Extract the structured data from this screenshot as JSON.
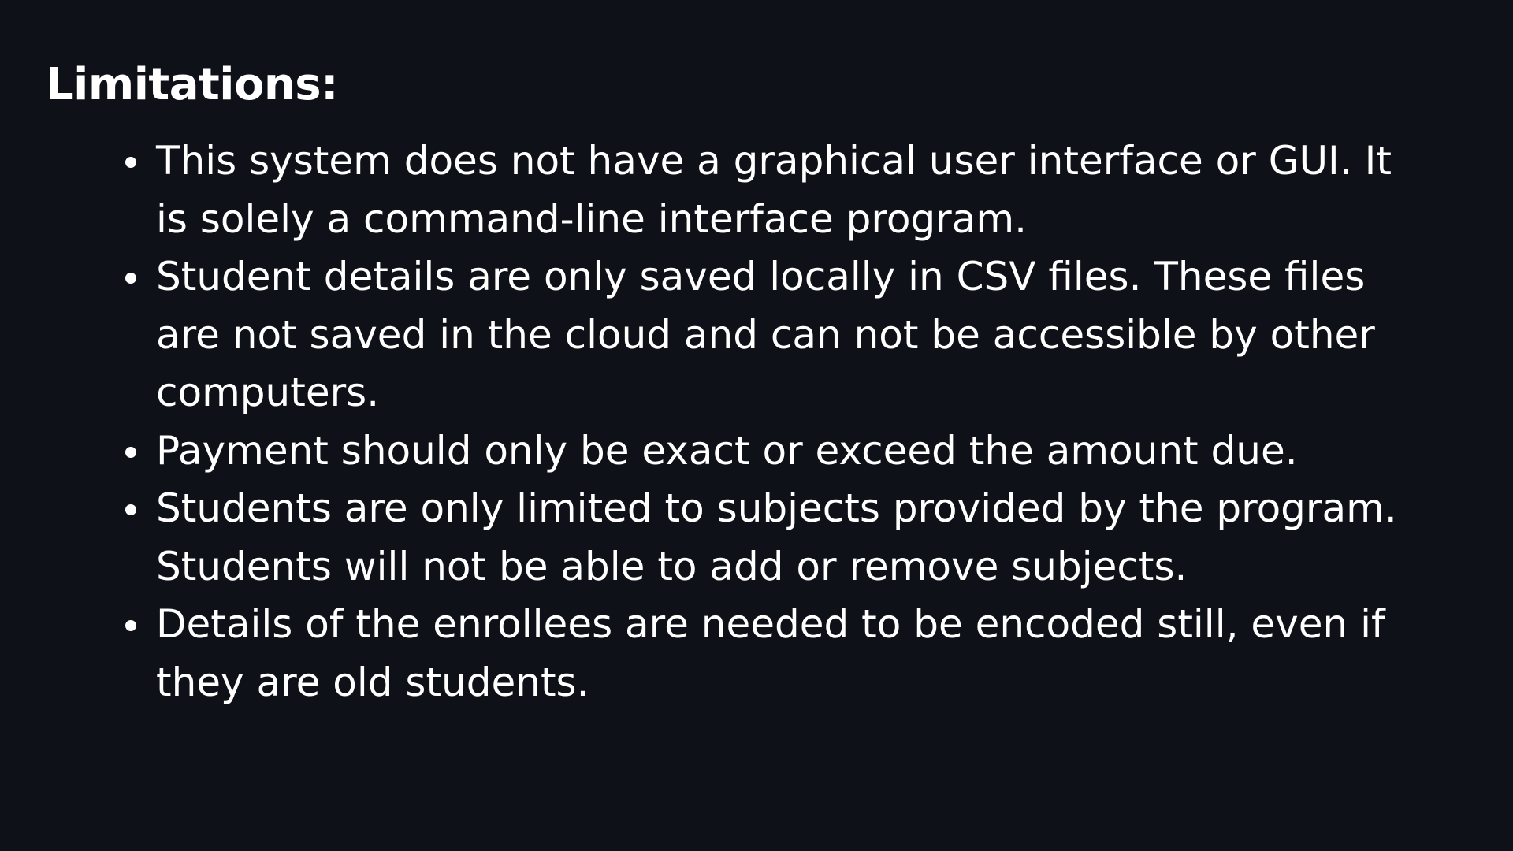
{
  "slide": {
    "heading": "Limitations:",
    "items": [
      "This system does not have a graphical user interface or GUI. It is solely a command-line interface program.",
      "Student details are only saved locally in CSV files. These files are not saved in the cloud and can not be accessible by other computers.",
      "Payment should only be exact or exceed the amount due.",
      "Students are only limited to subjects provided by the program. Students will not be able to add or remove subjects.",
      "Details of the enrollees are needed to be encoded still, even if they are old students."
    ]
  },
  "colors": {
    "background": "#0e1117",
    "text": "#ffffff"
  }
}
